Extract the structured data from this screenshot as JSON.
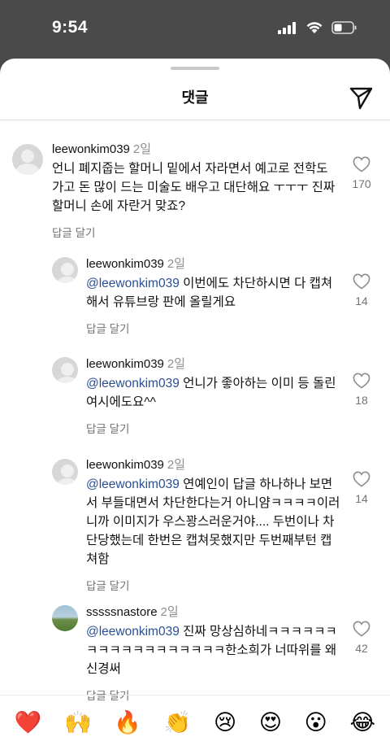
{
  "status": {
    "time": "9:54"
  },
  "header": {
    "title": "댓글"
  },
  "comments": [
    {
      "username": "leewonkim039",
      "time": "2일",
      "mention": "",
      "text": "언니 폐지줍는 할머니 밑에서 자라면서 예고로 전학도 가고 돈 많이 드는 미술도 배우고 대단해요 ㅜㅜㅜ 진짜 할머니 손에 자란거 맞죠?",
      "reply": "답글 달기",
      "likes": "170"
    },
    {
      "username": "leewonkim039",
      "time": "2일",
      "mention": "@leewonkim039",
      "text": " 이번에도 차단하시면 다 캡쳐해서 유튜브랑 판에 올릴게요",
      "reply": "답글 달기",
      "likes": "14"
    },
    {
      "username": "leewonkim039",
      "time": "2일",
      "mention": "@leewonkim039",
      "text": " 언니가 좋아하는 이미 등 돌린 여시에도요^^",
      "reply": "답글 달기",
      "likes": "18"
    },
    {
      "username": "leewonkim039",
      "time": "2일",
      "mention": "@leewonkim039",
      "text": " 연예인이 답글 하나하나 보면서 부들대면서 차단한다는거 아니얌ㅋㅋㅋㅋ이러니까 이미지가 우스꽝스러운거야.... 두번이나 차단당했는데 한번은 캡쳐못했지만 두번째부턴 캡쳐함",
      "reply": "답글 달기",
      "likes": "14"
    },
    {
      "username": "sssssnastore",
      "time": "2일",
      "mention": "@leewonkim039",
      "text": " 진짜 망상심하네ㅋㅋㅋㅋㅋㅋㅋㅋㅋㅋㅋㅋㅋㅋㅋㅋㅋㅋ한소희가 너따위를 왜 신경써",
      "reply": "답글 달기",
      "likes": "42"
    }
  ],
  "emojis": [
    "❤️",
    "🙌",
    "🔥",
    "👏",
    "😢",
    "😍",
    "😮",
    "😂"
  ]
}
